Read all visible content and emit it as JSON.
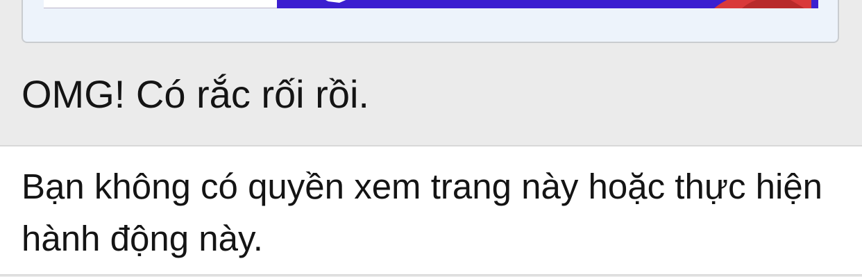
{
  "error": {
    "title": "OMG! Có rắc rối rồi.",
    "message": "Bạn không có quyền xem trang này hoặc thực hiện hành động này."
  },
  "colors": {
    "page_background": "#ebebeb",
    "card_background": "#edf3fb",
    "banner_accent": "#3b1fd0",
    "text": "#141414"
  }
}
